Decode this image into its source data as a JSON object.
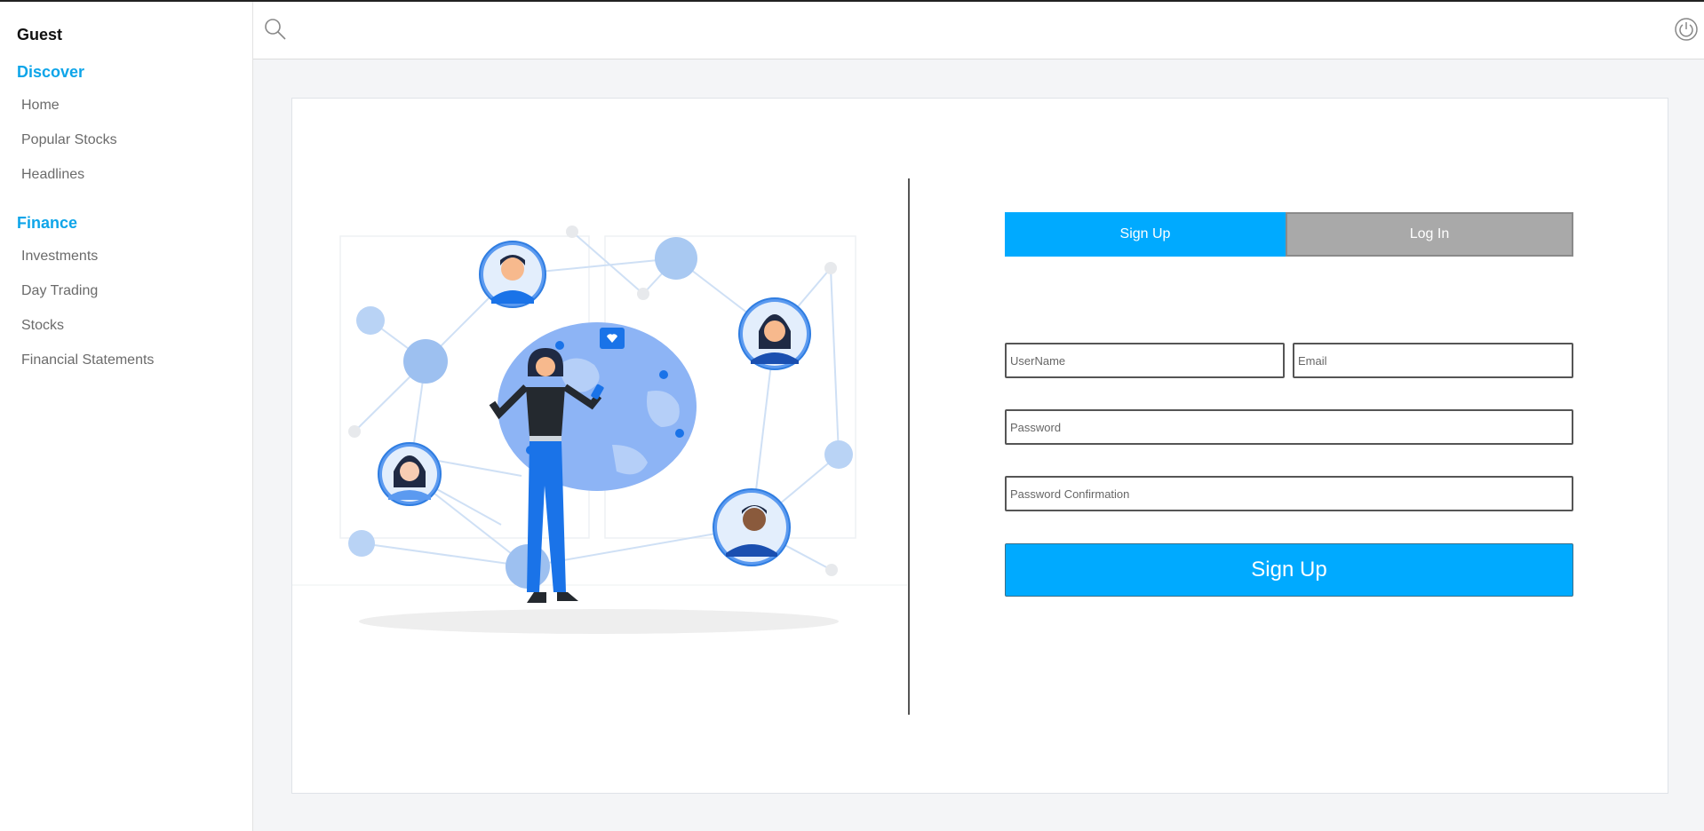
{
  "sidebar": {
    "user": "Guest",
    "sections": [
      {
        "title": "Discover",
        "items": [
          "Home",
          "Popular Stocks",
          "Headlines"
        ]
      },
      {
        "title": "Finance",
        "items": [
          "Investments",
          "Day Trading",
          "Stocks",
          "Financial Statements"
        ]
      }
    ]
  },
  "topbar": {
    "search_icon": "search-icon",
    "power_icon": "power-icon"
  },
  "auth": {
    "tabs": {
      "signup": "Sign Up",
      "login": "Log In",
      "active": "signup"
    },
    "fields": {
      "username": {
        "placeholder": "UserName",
        "value": ""
      },
      "email": {
        "placeholder": "Email",
        "value": ""
      },
      "password": {
        "placeholder": "Password",
        "value": ""
      },
      "password_confirmation": {
        "placeholder": "Password Confirmation",
        "value": ""
      }
    },
    "submit_label": "Sign Up"
  },
  "colors": {
    "accent": "#00aaff",
    "section": "#0ea5e9",
    "inactive_tab": "#a9a9a9"
  }
}
